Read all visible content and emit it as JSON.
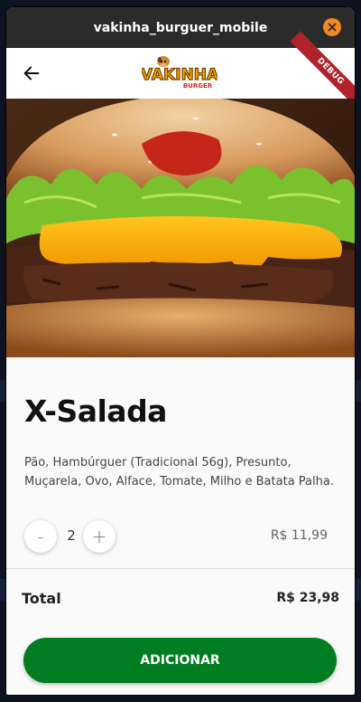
{
  "window": {
    "title": "vakinha_burguer_mobile"
  },
  "appbar": {
    "logo_text": "VAKINHA",
    "logo_sub": "BURGER",
    "debug_label": "DEBUG"
  },
  "product": {
    "name": "X-Salada",
    "description": "Pão, Hambúrguer (Tradicional 56g), Presunto, Muçarela, Ovo, Alface, Tomate, Milho e Batata Palha.",
    "quantity": "2",
    "unit_price": "R$ 11,99"
  },
  "quantity_controls": {
    "minus_label": "-",
    "plus_label": "+"
  },
  "summary": {
    "total_label": "Total",
    "total_value": "R$ 23,98"
  },
  "actions": {
    "add_label": "ADICIONAR"
  },
  "colors": {
    "accent": "#007d21",
    "titlebar": "#2b2b2b",
    "close": "#f08a24",
    "debug": "#b0232a"
  },
  "icons": {
    "back": "arrow-left-icon",
    "close": "close-icon"
  }
}
